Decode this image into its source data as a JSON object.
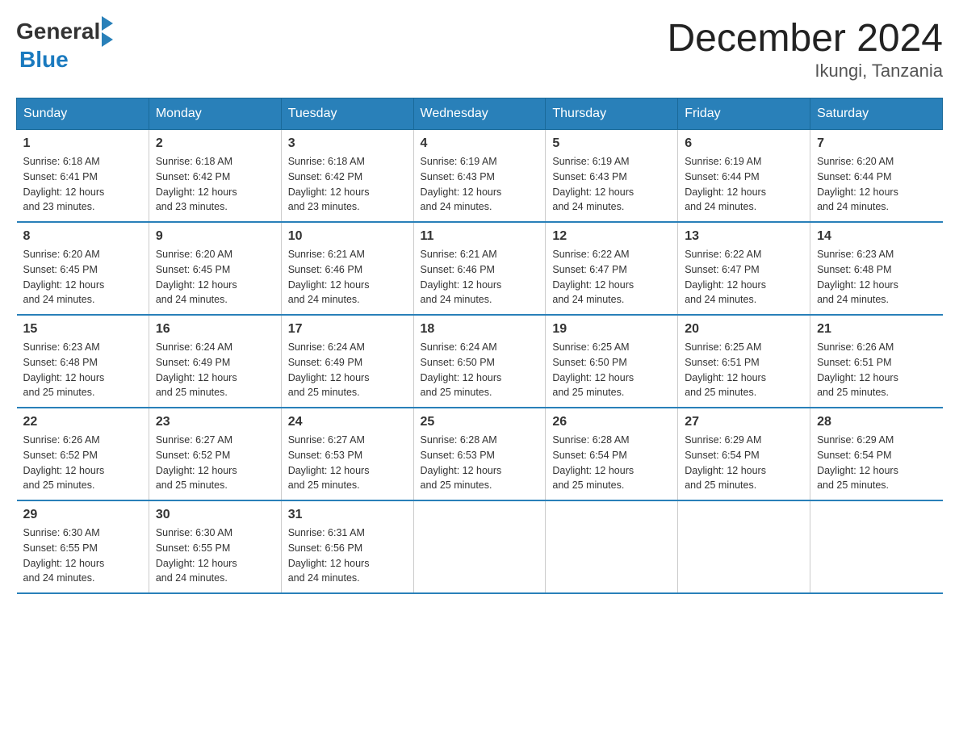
{
  "header": {
    "logo_general": "General",
    "logo_blue": "Blue",
    "title": "December 2024",
    "location": "Ikungi, Tanzania"
  },
  "days_of_week": [
    "Sunday",
    "Monday",
    "Tuesday",
    "Wednesday",
    "Thursday",
    "Friday",
    "Saturday"
  ],
  "weeks": [
    [
      {
        "day": "1",
        "sunrise": "6:18 AM",
        "sunset": "6:41 PM",
        "daylight": "12 hours and 23 minutes."
      },
      {
        "day": "2",
        "sunrise": "6:18 AM",
        "sunset": "6:42 PM",
        "daylight": "12 hours and 23 minutes."
      },
      {
        "day": "3",
        "sunrise": "6:18 AM",
        "sunset": "6:42 PM",
        "daylight": "12 hours and 23 minutes."
      },
      {
        "day": "4",
        "sunrise": "6:19 AM",
        "sunset": "6:43 PM",
        "daylight": "12 hours and 24 minutes."
      },
      {
        "day": "5",
        "sunrise": "6:19 AM",
        "sunset": "6:43 PM",
        "daylight": "12 hours and 24 minutes."
      },
      {
        "day": "6",
        "sunrise": "6:19 AM",
        "sunset": "6:44 PM",
        "daylight": "12 hours and 24 minutes."
      },
      {
        "day": "7",
        "sunrise": "6:20 AM",
        "sunset": "6:44 PM",
        "daylight": "12 hours and 24 minutes."
      }
    ],
    [
      {
        "day": "8",
        "sunrise": "6:20 AM",
        "sunset": "6:45 PM",
        "daylight": "12 hours and 24 minutes."
      },
      {
        "day": "9",
        "sunrise": "6:20 AM",
        "sunset": "6:45 PM",
        "daylight": "12 hours and 24 minutes."
      },
      {
        "day": "10",
        "sunrise": "6:21 AM",
        "sunset": "6:46 PM",
        "daylight": "12 hours and 24 minutes."
      },
      {
        "day": "11",
        "sunrise": "6:21 AM",
        "sunset": "6:46 PM",
        "daylight": "12 hours and 24 minutes."
      },
      {
        "day": "12",
        "sunrise": "6:22 AM",
        "sunset": "6:47 PM",
        "daylight": "12 hours and 24 minutes."
      },
      {
        "day": "13",
        "sunrise": "6:22 AM",
        "sunset": "6:47 PM",
        "daylight": "12 hours and 24 minutes."
      },
      {
        "day": "14",
        "sunrise": "6:23 AM",
        "sunset": "6:48 PM",
        "daylight": "12 hours and 24 minutes."
      }
    ],
    [
      {
        "day": "15",
        "sunrise": "6:23 AM",
        "sunset": "6:48 PM",
        "daylight": "12 hours and 25 minutes."
      },
      {
        "day": "16",
        "sunrise": "6:24 AM",
        "sunset": "6:49 PM",
        "daylight": "12 hours and 25 minutes."
      },
      {
        "day": "17",
        "sunrise": "6:24 AM",
        "sunset": "6:49 PM",
        "daylight": "12 hours and 25 minutes."
      },
      {
        "day": "18",
        "sunrise": "6:24 AM",
        "sunset": "6:50 PM",
        "daylight": "12 hours and 25 minutes."
      },
      {
        "day": "19",
        "sunrise": "6:25 AM",
        "sunset": "6:50 PM",
        "daylight": "12 hours and 25 minutes."
      },
      {
        "day": "20",
        "sunrise": "6:25 AM",
        "sunset": "6:51 PM",
        "daylight": "12 hours and 25 minutes."
      },
      {
        "day": "21",
        "sunrise": "6:26 AM",
        "sunset": "6:51 PM",
        "daylight": "12 hours and 25 minutes."
      }
    ],
    [
      {
        "day": "22",
        "sunrise": "6:26 AM",
        "sunset": "6:52 PM",
        "daylight": "12 hours and 25 minutes."
      },
      {
        "day": "23",
        "sunrise": "6:27 AM",
        "sunset": "6:52 PM",
        "daylight": "12 hours and 25 minutes."
      },
      {
        "day": "24",
        "sunrise": "6:27 AM",
        "sunset": "6:53 PM",
        "daylight": "12 hours and 25 minutes."
      },
      {
        "day": "25",
        "sunrise": "6:28 AM",
        "sunset": "6:53 PM",
        "daylight": "12 hours and 25 minutes."
      },
      {
        "day": "26",
        "sunrise": "6:28 AM",
        "sunset": "6:54 PM",
        "daylight": "12 hours and 25 minutes."
      },
      {
        "day": "27",
        "sunrise": "6:29 AM",
        "sunset": "6:54 PM",
        "daylight": "12 hours and 25 minutes."
      },
      {
        "day": "28",
        "sunrise": "6:29 AM",
        "sunset": "6:54 PM",
        "daylight": "12 hours and 25 minutes."
      }
    ],
    [
      {
        "day": "29",
        "sunrise": "6:30 AM",
        "sunset": "6:55 PM",
        "daylight": "12 hours and 24 minutes."
      },
      {
        "day": "30",
        "sunrise": "6:30 AM",
        "sunset": "6:55 PM",
        "daylight": "12 hours and 24 minutes."
      },
      {
        "day": "31",
        "sunrise": "6:31 AM",
        "sunset": "6:56 PM",
        "daylight": "12 hours and 24 minutes."
      },
      null,
      null,
      null,
      null
    ]
  ],
  "labels": {
    "sunrise": "Sunrise:",
    "sunset": "Sunset:",
    "daylight": "Daylight: 12 hours"
  }
}
